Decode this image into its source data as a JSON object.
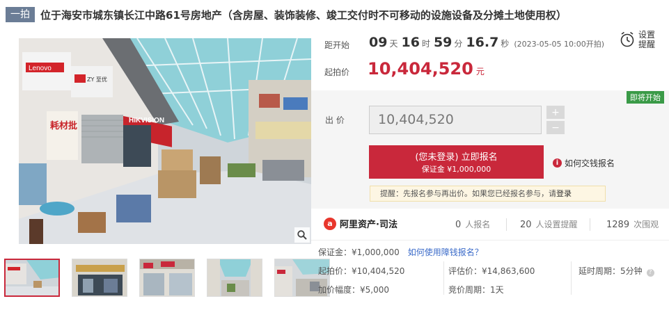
{
  "title": {
    "badge": "一拍",
    "text": "位于海安市城东镇长江中路61号房地产（含房屋、装饰装修、竣工交付时不可移动的设施设备及分摊土地使用权）"
  },
  "gallery": {
    "main_alt": "市场内景",
    "zoom_icon": "magnifier-icon",
    "thumbnails": [
      "thumb-1",
      "thumb-2",
      "thumb-3",
      "thumb-4",
      "thumb-5"
    ],
    "shop_signs": [
      "Lenovo",
      "ZY 至优",
      "HIKVISION",
      "耗材批"
    ]
  },
  "countdown": {
    "label": "距开始",
    "days": "09",
    "days_unit": "天",
    "hours": "16",
    "hours_unit": "时",
    "minutes": "59",
    "minutes_unit": "分",
    "seconds": "16.7",
    "seconds_unit": "秒",
    "start_time": "(2023-05-05 10:00开拍)"
  },
  "reminder": {
    "line1": "设置",
    "line2": "提醒",
    "icon": "alarm-clock-icon"
  },
  "starting_price": {
    "label": "起拍价",
    "value": "10,404,520",
    "currency": "元"
  },
  "bid": {
    "status_tag": "即将开始",
    "label": "出 价",
    "input_value": "10,404,520",
    "plus": "+",
    "minus": "−",
    "signup_line1": "(您未登录) 立即报名",
    "signup_line2": "保证金 ¥1,000,000",
    "how_pay": "如何交钱报名",
    "notice_prefix": "提醒：先报名参与再出价。如果您已经报名参与，请",
    "notice_link": "登录"
  },
  "stats": {
    "brand": "阿里资产·司法",
    "signups": "0",
    "signups_unit": "人报名",
    "reminders": "20",
    "reminders_unit": "人设置提醒",
    "views": "1289",
    "views_unit": "次围观"
  },
  "details": {
    "deposit": "保证金：¥1,000,000",
    "deposit_link": "如何使用障钱报名？",
    "start_price": "起拍价：¥10,404,520",
    "assessed": "评估价：¥14,863,600",
    "delay": "延时周期：5分钟",
    "increment": "加价幅度：¥5,000",
    "cycle": "竞价周期：1天"
  },
  "colors": {
    "accent": "#c9283b",
    "tag_green": "#3a9a47",
    "badge": "#6b7d96"
  }
}
